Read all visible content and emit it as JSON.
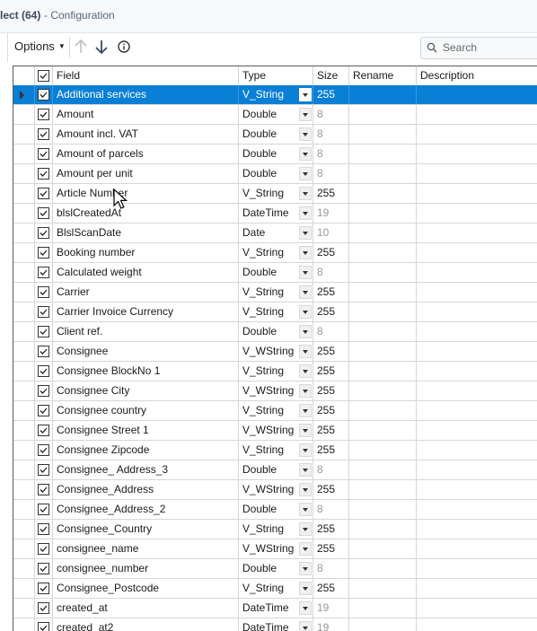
{
  "window": {
    "title_fragment": "lect (64)",
    "subtitle": "- Configuration"
  },
  "toolbar": {
    "options_label": "Options",
    "move_up_icon": "arrow-up-icon",
    "move_down_icon": "arrow-down-icon",
    "info_icon": "info-icon",
    "search_placeholder": "Search"
  },
  "grid": {
    "columns": [
      "Field",
      "Type",
      "Size",
      "Rename",
      "Description"
    ],
    "rows": [
      {
        "field": "Additional services",
        "type": "V_String",
        "size": "255",
        "selected": true
      },
      {
        "field": "Amount",
        "type": "Double",
        "size": "8"
      },
      {
        "field": "Amount incl. VAT",
        "type": "Double",
        "size": "8"
      },
      {
        "field": "Amount of parcels",
        "type": "Double",
        "size": "8"
      },
      {
        "field": "Amount per unit",
        "type": "Double",
        "size": "8"
      },
      {
        "field": "Article Number",
        "type": "V_String",
        "size": "255"
      },
      {
        "field": "blslCreatedAt",
        "type": "DateTime",
        "size": "19"
      },
      {
        "field": "BlslScanDate",
        "type": "Date",
        "size": "10"
      },
      {
        "field": "Booking number",
        "type": "V_String",
        "size": "255"
      },
      {
        "field": "Calculated weight",
        "type": "Double",
        "size": "8"
      },
      {
        "field": "Carrier",
        "type": "V_String",
        "size": "255"
      },
      {
        "field": "Carrier Invoice Currency",
        "type": "V_String",
        "size": "255"
      },
      {
        "field": "Client ref.",
        "type": "Double",
        "size": "8"
      },
      {
        "field": "Consignee",
        "type": "V_WString",
        "size": "255"
      },
      {
        "field": "Consignee BlockNo 1",
        "type": "V_String",
        "size": "255"
      },
      {
        "field": "Consignee City",
        "type": "V_WString",
        "size": "255"
      },
      {
        "field": "Consignee country",
        "type": "V_String",
        "size": "255"
      },
      {
        "field": "Consignee Street 1",
        "type": "V_WString",
        "size": "255"
      },
      {
        "field": "Consignee Zipcode",
        "type": "V_String",
        "size": "255"
      },
      {
        "field": "Consignee_ Address_3",
        "type": "Double",
        "size": "8"
      },
      {
        "field": "Consignee_Address",
        "type": "V_WString",
        "size": "255"
      },
      {
        "field": "Consignee_Address_2",
        "type": "Double",
        "size": "8"
      },
      {
        "field": "Consignee_Country",
        "type": "V_String",
        "size": "255"
      },
      {
        "field": "consignee_name",
        "type": "V_WString",
        "size": "255"
      },
      {
        "field": "consignee_number",
        "type": "Double",
        "size": "8"
      },
      {
        "field": "Consignee_Postcode",
        "type": "V_String",
        "size": "255"
      },
      {
        "field": "created_at",
        "type": "DateTime",
        "size": "19"
      },
      {
        "field": "created_at2",
        "type": "DateTime",
        "size": "19"
      }
    ]
  }
}
